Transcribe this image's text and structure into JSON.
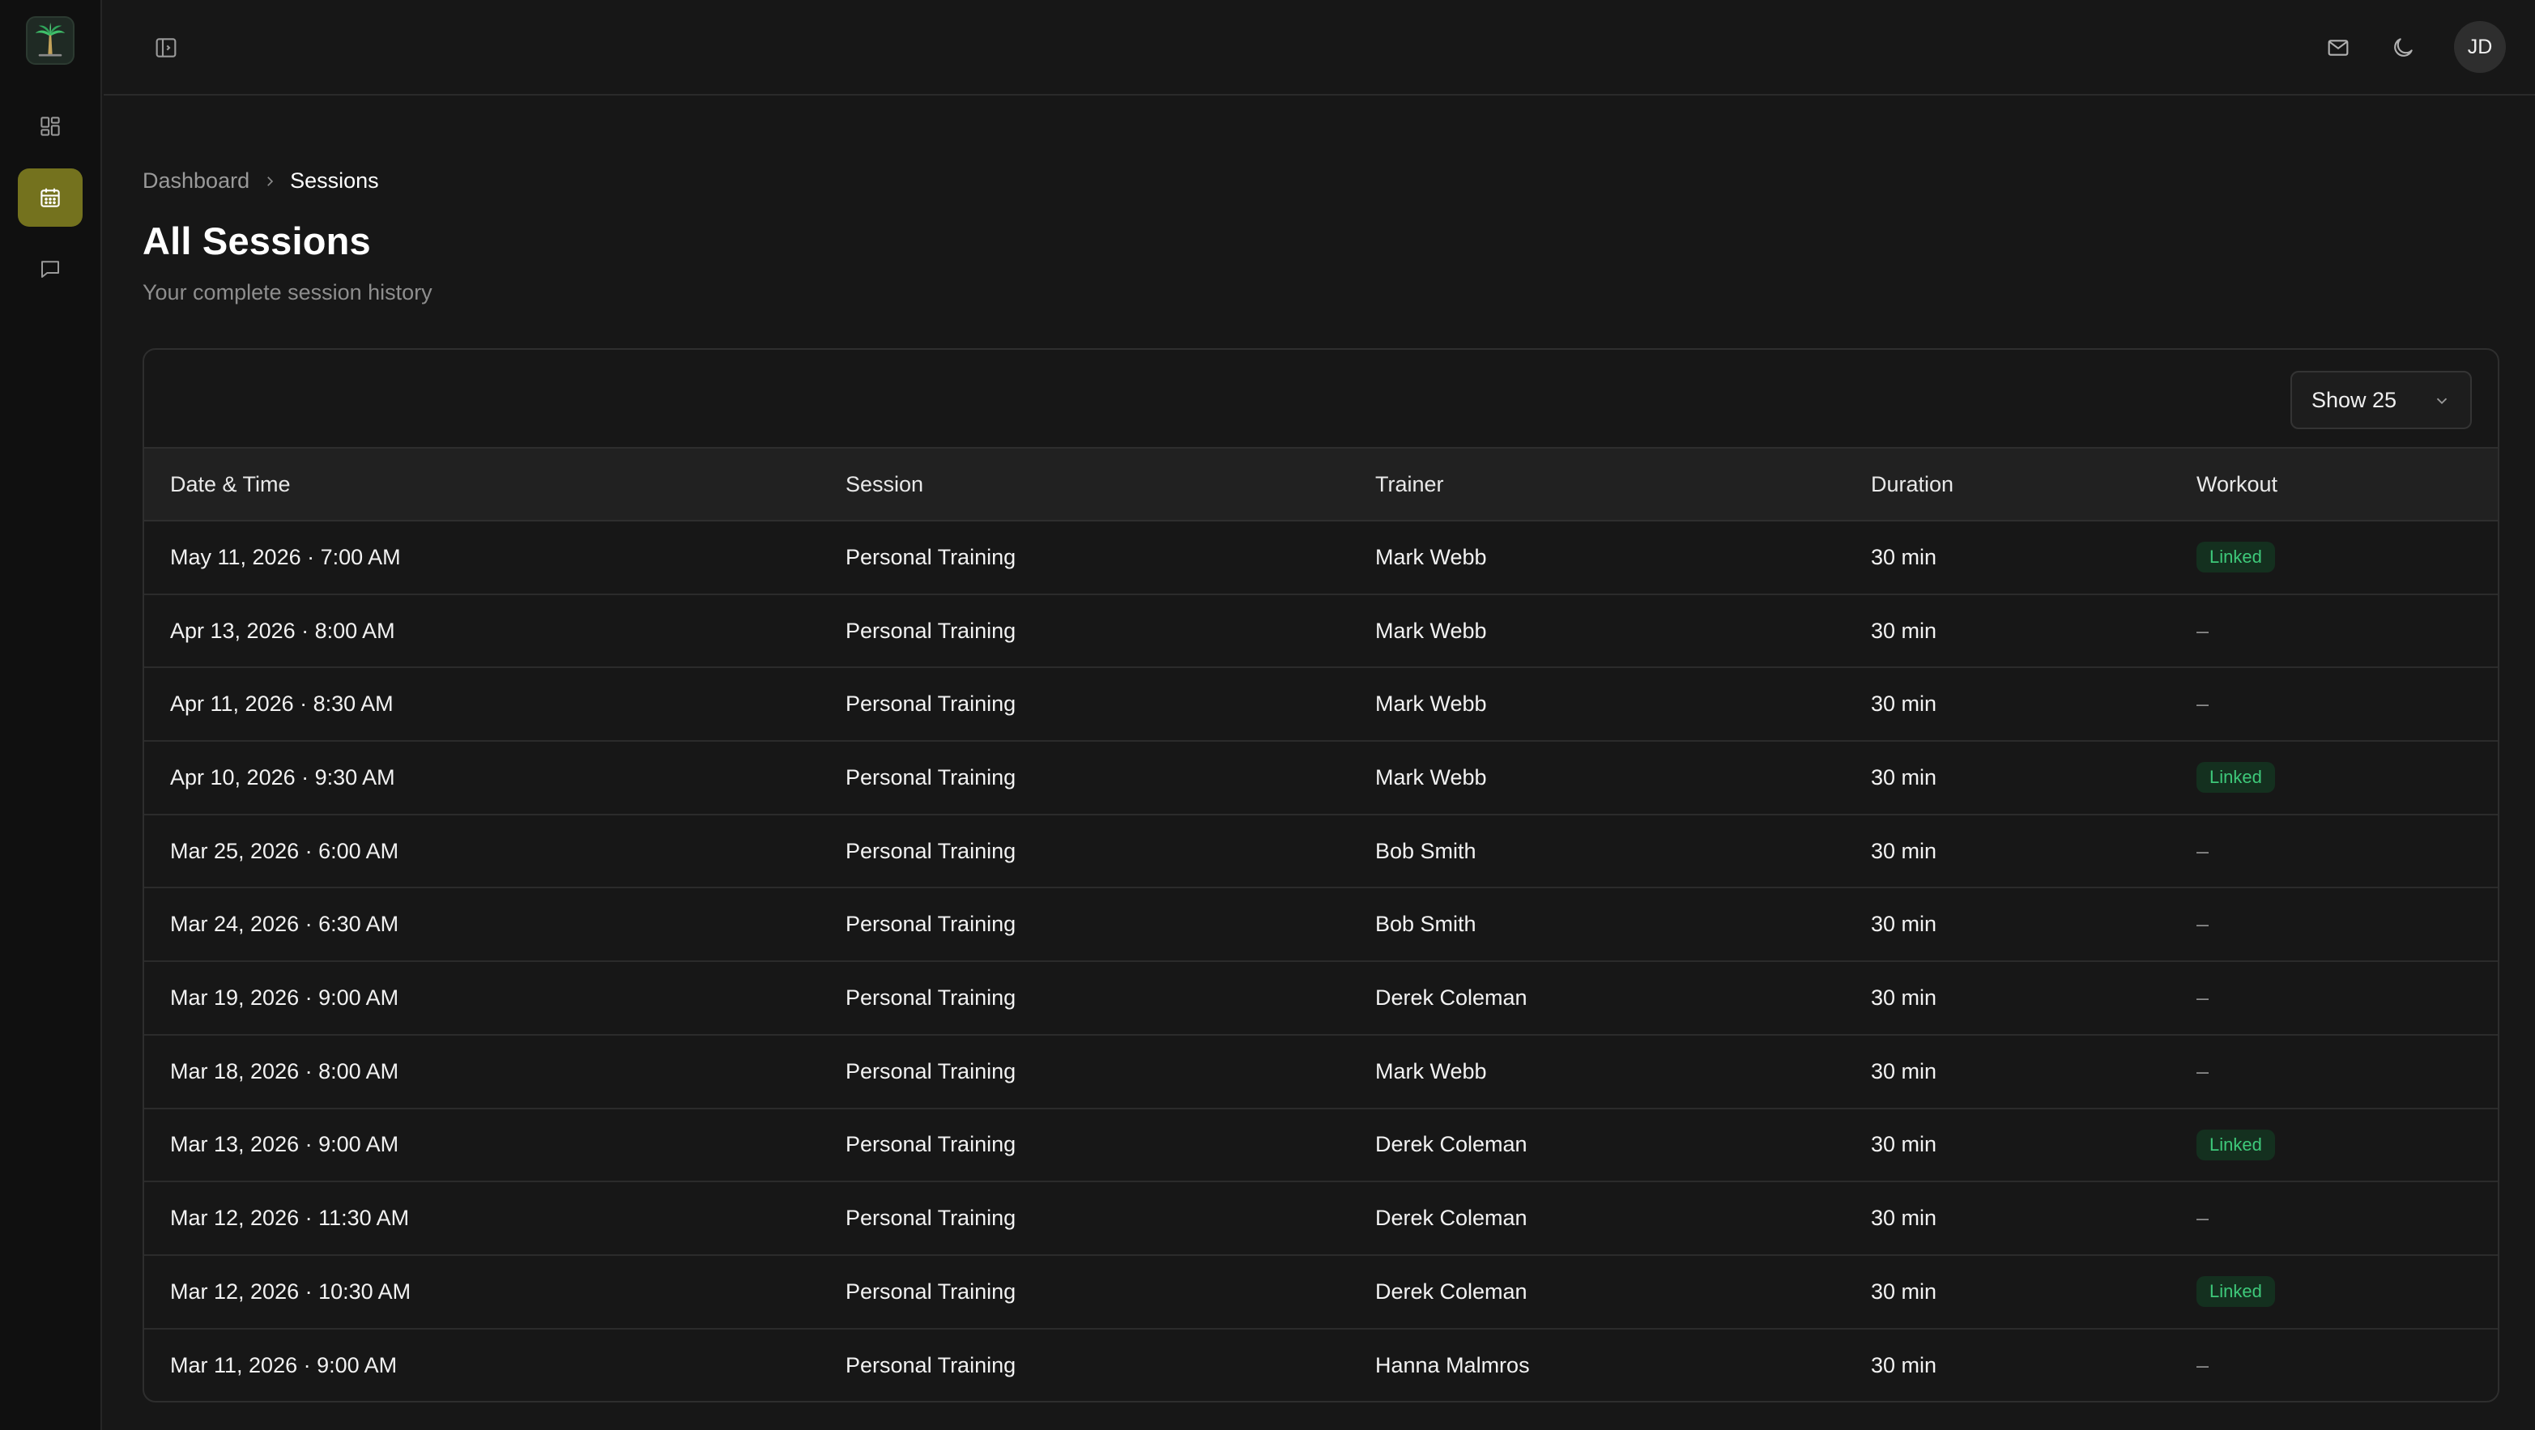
{
  "breadcrumb": {
    "parent": "Dashboard",
    "current": "Sessions"
  },
  "page": {
    "title": "All Sessions",
    "subtitle": "Your complete session history"
  },
  "topbar": {
    "avatar_initials": "JD"
  },
  "sidebar": {
    "items": [
      {
        "icon": "dashboard-grid-icon",
        "active": false
      },
      {
        "icon": "calendar-icon",
        "active": true
      },
      {
        "icon": "message-icon",
        "active": false
      }
    ]
  },
  "table": {
    "page_size_label": "Show 25",
    "columns": [
      "Date & Time",
      "Session",
      "Trainer",
      "Duration",
      "Workout"
    ],
    "rows": [
      {
        "datetime": "May 11, 2026 · 7:00 AM",
        "session": "Personal Training",
        "trainer": "Mark Webb",
        "duration": "30 min",
        "workout": "Linked"
      },
      {
        "datetime": "Apr 13, 2026 · 8:00 AM",
        "session": "Personal Training",
        "trainer": "Mark Webb",
        "duration": "30 min",
        "workout": "–"
      },
      {
        "datetime": "Apr 11, 2026 · 8:30 AM",
        "session": "Personal Training",
        "trainer": "Mark Webb",
        "duration": "30 min",
        "workout": "–"
      },
      {
        "datetime": "Apr 10, 2026 · 9:30 AM",
        "session": "Personal Training",
        "trainer": "Mark Webb",
        "duration": "30 min",
        "workout": "Linked"
      },
      {
        "datetime": "Mar 25, 2026 · 6:00 AM",
        "session": "Personal Training",
        "trainer": "Bob Smith",
        "duration": "30 min",
        "workout": "–"
      },
      {
        "datetime": "Mar 24, 2026 · 6:30 AM",
        "session": "Personal Training",
        "trainer": "Bob Smith",
        "duration": "30 min",
        "workout": "–"
      },
      {
        "datetime": "Mar 19, 2026 · 9:00 AM",
        "session": "Personal Training",
        "trainer": "Derek Coleman",
        "duration": "30 min",
        "workout": "–"
      },
      {
        "datetime": "Mar 18, 2026 · 8:00 AM",
        "session": "Personal Training",
        "trainer": "Mark Webb",
        "duration": "30 min",
        "workout": "–"
      },
      {
        "datetime": "Mar 13, 2026 · 9:00 AM",
        "session": "Personal Training",
        "trainer": "Derek Coleman",
        "duration": "30 min",
        "workout": "Linked"
      },
      {
        "datetime": "Mar 12, 2026 · 11:30 AM",
        "session": "Personal Training",
        "trainer": "Derek Coleman",
        "duration": "30 min",
        "workout": "–"
      },
      {
        "datetime": "Mar 12, 2026 · 10:30 AM",
        "session": "Personal Training",
        "trainer": "Derek Coleman",
        "duration": "30 min",
        "workout": "Linked"
      },
      {
        "datetime": "Mar 11, 2026 · 9:00 AM",
        "session": "Personal Training",
        "trainer": "Hanna Malmros",
        "duration": "30 min",
        "workout": "–"
      }
    ]
  },
  "colors": {
    "accent": "#74721e",
    "linked_text": "#3ec97a",
    "linked_bg": "#14301f"
  }
}
